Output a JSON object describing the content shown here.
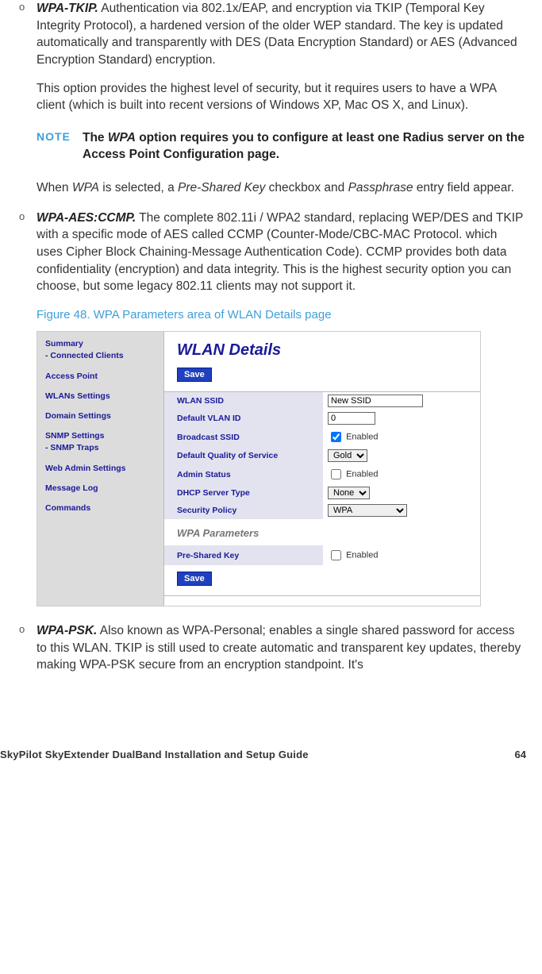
{
  "bullet": "o",
  "items": {
    "wpa_tkip": {
      "term": "WPA-TKIP.",
      "text": " Authentication via 802.1x/EAP, and encryption via TKIP (Temporal Key Integrity Protocol), a hardened version of the older WEP standard. The key is updated automatically and transparently with DES (Data Encryption Standard) or AES (Advanced Encryption Standard) encryption.",
      "para2": "This option provides the highest level of security, but it requires users to have a WPA client (which is built into recent versions of Windows XP, Mac OS X, and Linux).",
      "post_note_prefix": "When ",
      "post_note_wpa": "WPA",
      "post_note_mid1": " is selected, a ",
      "post_note_psk": "Pre-Shared Key",
      "post_note_mid2": " checkbox and ",
      "post_note_pass": "Passphrase",
      "post_note_suffix": " entry field appear."
    },
    "wpa_aes": {
      "term": "WPA-AES:CCMP.",
      "text": " The complete 802.11i / WPA2 standard, replacing WEP/DES and TKIP with a specific mode of AES called CCMP (Counter-Mode/CBC-MAC Protocol. which uses Cipher Block Chaining-Message Authentication Code). CCMP provides both data confidentiality (encryption) and data integrity. This is the highest security option you can choose, but some legacy 802.11 clients may not support it."
    },
    "wpa_psk": {
      "term": "WPA-PSK.",
      "text": " Also known as WPA-Personal; enables a single shared password for access to this WLAN. TKIP is still used to create automatic and transparent key updates, thereby making WPA-PSK secure from an encryption standpoint. It's"
    }
  },
  "note": {
    "label": "NOTE",
    "prefix": "The ",
    "wpa": "WPA",
    "suffix": " option requires you to configure at least one Radius server on the Access Point Configuration page."
  },
  "figure_caption": "Figure 48. WPA Parameters area of WLAN Details page",
  "screenshot": {
    "sidebar": {
      "summary": "Summary",
      "connected": "- Connected Clients",
      "access_point": "Access Point",
      "wlans": "WLANs Settings",
      "domain": "Domain Settings",
      "snmp": "SNMP Settings",
      "snmp_traps": "- SNMP Traps",
      "web_admin": "Web Admin Settings",
      "msg_log": "Message Log",
      "commands": "Commands"
    },
    "title": "WLAN Details",
    "save": "Save",
    "rows": {
      "ssid_label": "WLAN SSID",
      "ssid_value": "New SSID",
      "vlan_label": "Default VLAN ID",
      "vlan_value": "0",
      "broadcast_label": "Broadcast SSID",
      "qos_label": "Default Quality of Service",
      "qos_value": "Gold",
      "admin_label": "Admin Status",
      "dhcp_label": "DHCP Server Type",
      "dhcp_value": "None",
      "sec_label": "Security Policy",
      "sec_value": "WPA"
    },
    "enabled_label": "Enabled",
    "subhead": "WPA Parameters",
    "psk_label": "Pre-Shared Key"
  },
  "footer": {
    "title": "SkyPilot SkyExtender DualBand Installation and Setup Guide",
    "page": "64"
  }
}
